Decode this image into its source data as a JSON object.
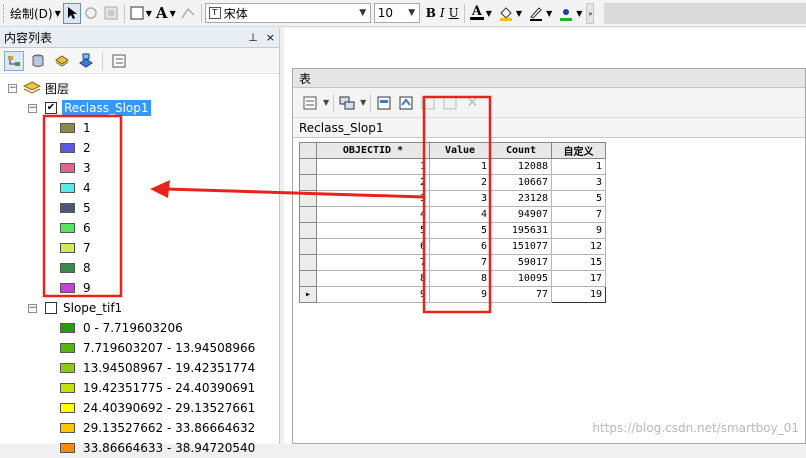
{
  "toolbar": {
    "draw_label": "绘制(D)",
    "font_name": "宋体",
    "font_size": "10",
    "bold": "B",
    "italic": "I",
    "underline": "U",
    "text_color_letter": "A",
    "text_icon_letter": "A"
  },
  "toc": {
    "title": "内容列表",
    "pin": "ᛝ",
    "close": "×",
    "layers_group": "图层",
    "layers": [
      {
        "name": "Reclass_Slop1",
        "checked": true,
        "classes": [
          {
            "label": "1",
            "color": "#8c8a4b"
          },
          {
            "label": "2",
            "color": "#5a5ae6"
          },
          {
            "label": "3",
            "color": "#e0668e"
          },
          {
            "label": "4",
            "color": "#55ece5"
          },
          {
            "label": "5",
            "color": "#4c5a78"
          },
          {
            "label": "6",
            "color": "#56e65c"
          },
          {
            "label": "7",
            "color": "#d6e65a"
          },
          {
            "label": "8",
            "color": "#3b8a4c"
          },
          {
            "label": "9",
            "color": "#c045d6"
          }
        ]
      },
      {
        "name": "Slope_tif1",
        "checked": false,
        "classes": [
          {
            "label": "0 - 7.719603206",
            "color": "#2e9a14"
          },
          {
            "label": "7.719603207 - 13.94508966",
            "color": "#58b410"
          },
          {
            "label": "13.94508967 - 19.42351774",
            "color": "#8ccc0c"
          },
          {
            "label": "19.42351775 - 24.40390691",
            "color": "#c4e20a"
          },
          {
            "label": "24.40390692 - 29.13527661",
            "color": "#ffff00"
          },
          {
            "label": "29.13527662 - 33.86664632",
            "color": "#ffc400"
          },
          {
            "label": "33.86664633 - 38.94720540",
            "color": "#ff8c00"
          }
        ]
      }
    ]
  },
  "table_window": {
    "title": "表",
    "tab_name": "Reclass_Slop1",
    "columns": [
      "OBJECTID *",
      "Value",
      "Count",
      "自定义"
    ],
    "rows": [
      [
        "1",
        "1",
        "12088",
        "1"
      ],
      [
        "2",
        "2",
        "10667",
        "3"
      ],
      [
        "3",
        "3",
        "23128",
        "5"
      ],
      [
        "4",
        "4",
        "94907",
        "7"
      ],
      [
        "5",
        "5",
        "195631",
        "9"
      ],
      [
        "6",
        "6",
        "151077",
        "12"
      ],
      [
        "7",
        "7",
        "59017",
        "15"
      ],
      [
        "8",
        "8",
        "10095",
        "17"
      ],
      [
        "9",
        "9",
        "77",
        "19"
      ]
    ],
    "current_row_marker": "▸"
  },
  "watermark": "https://blog.csdn.net/smartboy_01",
  "annotation_color": "#e8231b"
}
